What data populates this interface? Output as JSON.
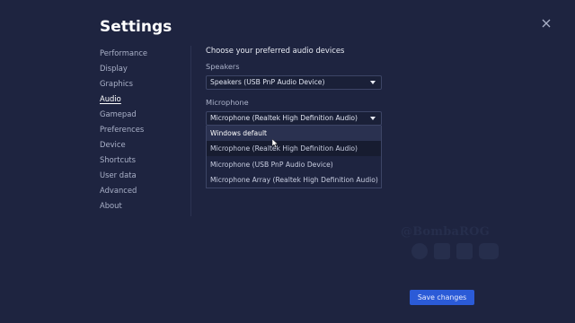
{
  "header": {
    "title": "Settings"
  },
  "sidebar": {
    "items": [
      {
        "label": "Performance"
      },
      {
        "label": "Display"
      },
      {
        "label": "Graphics"
      },
      {
        "label": "Audio"
      },
      {
        "label": "Gamepad"
      },
      {
        "label": "Preferences"
      },
      {
        "label": "Device"
      },
      {
        "label": "Shortcuts"
      },
      {
        "label": "User data"
      },
      {
        "label": "Advanced"
      },
      {
        "label": "About"
      }
    ],
    "active": "Audio"
  },
  "audio": {
    "heading": "Choose your preferred audio devices",
    "speakers_label": "Speakers",
    "speakers_value": "Speakers (USB PnP Audio Device)",
    "microphone_label": "Microphone",
    "microphone_value": "Microphone (Realtek High Definition Audio)",
    "microphone_options": [
      {
        "label": "Windows default"
      },
      {
        "label": "Microphone (Realtek High Definition Audio)"
      },
      {
        "label": "Microphone (USB PnP Audio Device)"
      },
      {
        "label": "Microphone Array (Realtek High Definition Audio)"
      }
    ]
  },
  "watermark": {
    "text": "@BombaROG"
  },
  "footer": {
    "save_label": "Save changes"
  },
  "colors": {
    "background": "#1e2440",
    "accent": "#2b5bd7"
  }
}
